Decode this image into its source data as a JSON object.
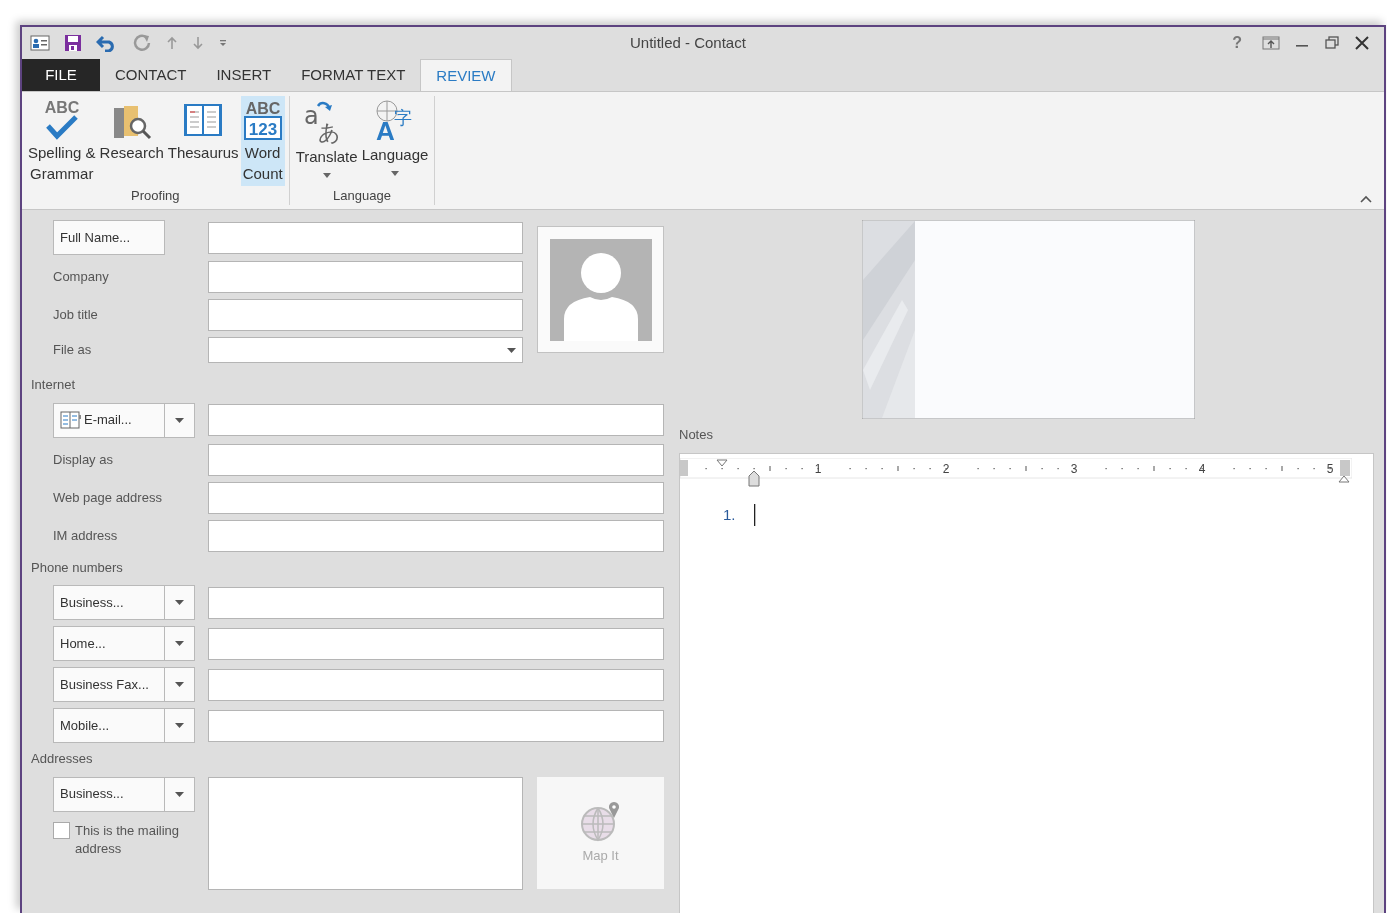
{
  "window": {
    "title": "Untitled - Contact",
    "help": "?"
  },
  "tabs": [
    {
      "label": "FILE",
      "kind": "file",
      "selected": false
    },
    {
      "label": "CONTACT",
      "kind": "tab",
      "selected": false
    },
    {
      "label": "INSERT",
      "kind": "tab",
      "selected": false
    },
    {
      "label": "FORMAT TEXT",
      "kind": "tab",
      "selected": false
    },
    {
      "label": "REVIEW",
      "kind": "tab",
      "selected": true
    }
  ],
  "ribbon": {
    "groups": [
      {
        "label": "Proofing",
        "buttons": [
          {
            "label": "Spelling & Grammar",
            "kind": "spelling",
            "icon_text": [
              "ABC"
            ],
            "highlighted": false,
            "dropdown": false
          },
          {
            "label": "Research",
            "kind": "research",
            "highlighted": false,
            "dropdown": false
          },
          {
            "label": "Thesaurus",
            "kind": "thesaurus",
            "highlighted": false,
            "dropdown": false
          },
          {
            "label": "Word Count",
            "kind": "wordcount",
            "icon_text": [
              "ABC",
              "123"
            ],
            "highlighted": true,
            "dropdown": false
          }
        ]
      },
      {
        "label": "Language",
        "buttons": [
          {
            "label": "Translate",
            "kind": "translate",
            "icon_text": [
              "a",
              "あ"
            ],
            "highlighted": false,
            "dropdown": true
          },
          {
            "label": "Language",
            "kind": "language",
            "icon_text": [
              "A",
              "字"
            ],
            "highlighted": false,
            "dropdown": true
          }
        ]
      }
    ]
  },
  "name_rows": [
    {
      "kind": "button",
      "label": "Full Name..."
    },
    {
      "kind": "label",
      "label": "Company"
    },
    {
      "kind": "label",
      "label": "Job title"
    },
    {
      "kind": "select",
      "label": "File as"
    }
  ],
  "sections": [
    {
      "heading": "Internet",
      "rows": [
        {
          "kind": "dropdown_button",
          "label": "E-mail...",
          "has_icon": true
        },
        {
          "kind": "label",
          "label": "Display as"
        },
        {
          "kind": "label",
          "label": "Web page address"
        },
        {
          "kind": "label",
          "label": "IM address"
        }
      ]
    },
    {
      "heading": "Phone numbers",
      "rows": [
        {
          "kind": "dropdown_button",
          "label": "Business...",
          "has_icon": false
        },
        {
          "kind": "dropdown_button",
          "label": "Home...",
          "has_icon": false
        },
        {
          "kind": "dropdown_button",
          "label": "Business Fax...",
          "has_icon": false
        },
        {
          "kind": "dropdown_button",
          "label": "Mobile...",
          "has_icon": false
        }
      ]
    }
  ],
  "addresses": {
    "heading": "Addresses",
    "type_button": "Business...",
    "mailing_checkbox": {
      "label": "This is the mailing address",
      "checked": false
    },
    "map_button": {
      "label": "Map It",
      "disabled": true
    }
  },
  "notes": {
    "label": "Notes",
    "ruler_numbers": [
      "1",
      "2",
      "3",
      "4",
      "5"
    ],
    "list_number": "1."
  }
}
